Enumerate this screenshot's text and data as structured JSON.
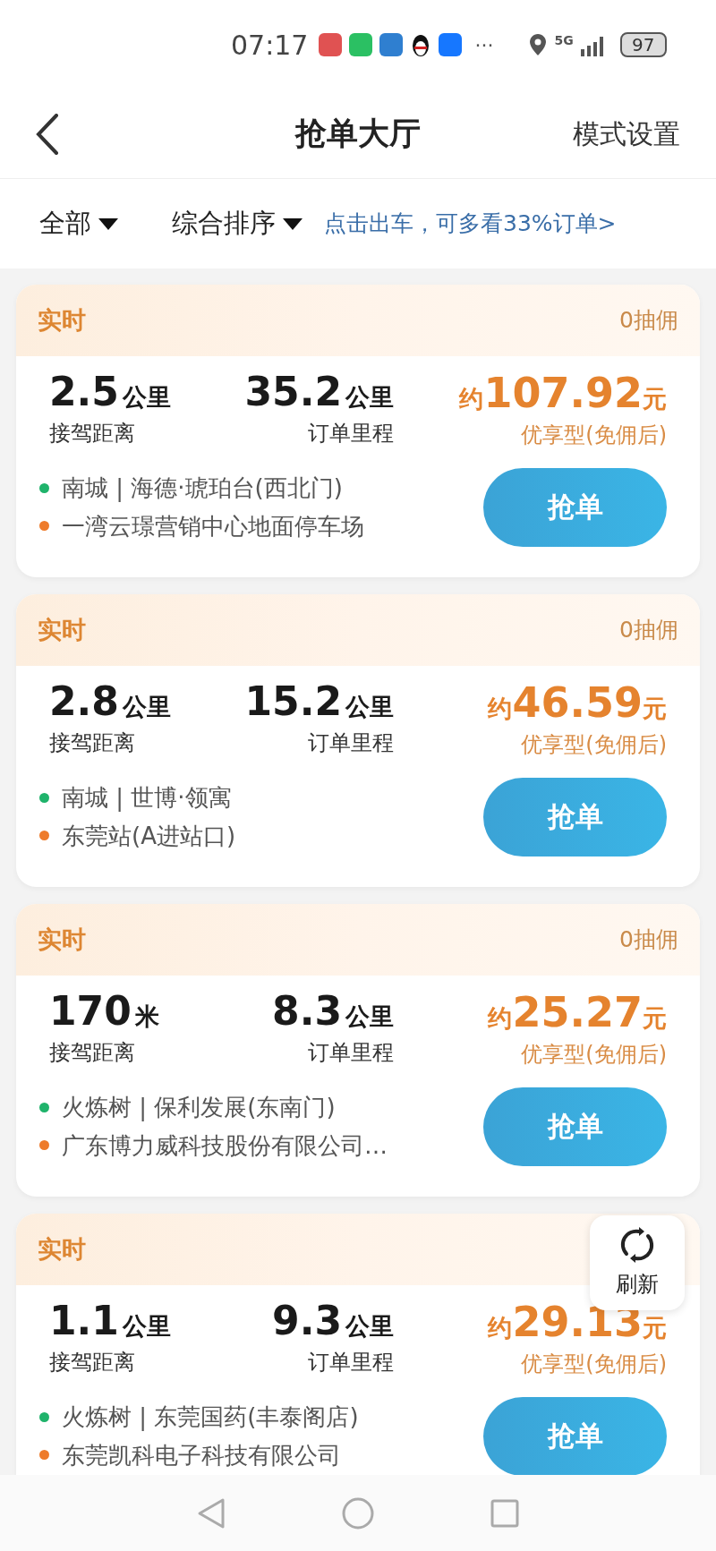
{
  "status_bar": {
    "time": "07:17",
    "more": "···",
    "network": "5G",
    "battery": "97"
  },
  "header": {
    "title": "抢单大厅",
    "action": "模式设置"
  },
  "filters": [
    {
      "label": "全部"
    },
    {
      "label": "综合排序"
    }
  ],
  "promo": "点击出车，可多看33%订单>",
  "orders": [
    {
      "tag": "实时",
      "commission": "0抽佣",
      "pickup": {
        "value": "2.5",
        "unit": "公里",
        "label": "接驾距离"
      },
      "trip": {
        "value": "35.2",
        "unit": "公里",
        "label": "订单里程"
      },
      "price": {
        "prefix": "约",
        "value": "107.92",
        "unit": "元"
      },
      "car_type": "优享型(免佣后)",
      "start": "南城 | 海德·琥珀台(西北门)",
      "end": "一湾云璟营销中心地面停车场",
      "button": "抢单"
    },
    {
      "tag": "实时",
      "commission": "0抽佣",
      "pickup": {
        "value": "2.8",
        "unit": "公里",
        "label": "接驾距离"
      },
      "trip": {
        "value": "15.2",
        "unit": "公里",
        "label": "订单里程"
      },
      "price": {
        "prefix": "约",
        "value": "46.59",
        "unit": "元"
      },
      "car_type": "优享型(免佣后)",
      "start": "南城 | 世博·领寓",
      "end": "东莞站(A进站口)",
      "button": "抢单"
    },
    {
      "tag": "实时",
      "commission": "0抽佣",
      "pickup": {
        "value": "170",
        "unit": "米",
        "label": "接驾距离"
      },
      "trip": {
        "value": "8.3",
        "unit": "公里",
        "label": "订单里程"
      },
      "price": {
        "prefix": "约",
        "value": "25.27",
        "unit": "元"
      },
      "car_type": "优享型(免佣后)",
      "start": "火炼树 | 保利发展(东南门)",
      "end": "广东博力威科技股份有限公司…",
      "button": "抢单"
    },
    {
      "tag": "实时",
      "pickup": {
        "value": "1.1",
        "unit": "公里",
        "label": "接驾距离"
      },
      "trip": {
        "value": "9.3",
        "unit": "公里",
        "label": "订单里程"
      },
      "price": {
        "prefix": "约",
        "value": "29.13",
        "unit": "元"
      },
      "car_type": "优享型(免佣后)",
      "start": "火炼树 | 东莞国药(丰泰阁店)",
      "end": "东莞凯科电子科技有限公司",
      "button": "抢单"
    }
  ],
  "refresh": {
    "label": "刷新"
  }
}
